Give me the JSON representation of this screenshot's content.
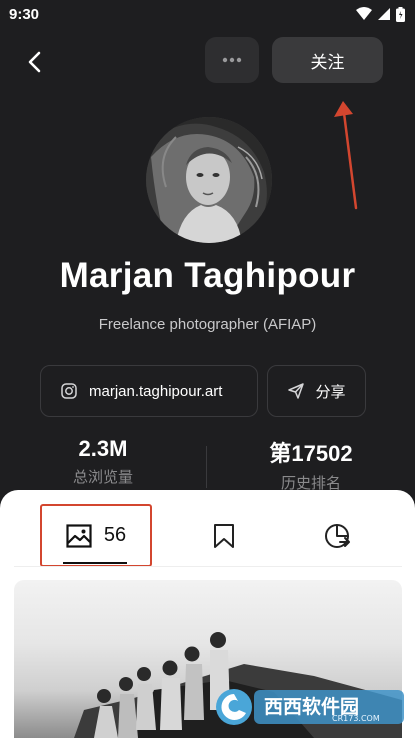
{
  "status_bar": {
    "time": "9:30"
  },
  "header": {
    "follow_label": "关注"
  },
  "profile": {
    "name": "Marjan Taghipour",
    "bio": "Freelance photographer (AFIAP)",
    "instagram_handle": "marjan.taghipour.art",
    "share_label": "分享"
  },
  "stats": {
    "views_value": "2.3M",
    "views_label": "总浏览量",
    "rank_value": "第17502",
    "rank_label": "历史排名"
  },
  "tabs": {
    "gallery_count": "56"
  },
  "watermark": {
    "brand": "西西软件园",
    "site": "CR173.COM"
  },
  "colors": {
    "background": "#1e1e20",
    "annotation_red": "#d3462f",
    "sheet": "#ffffff"
  },
  "icons": [
    "back-icon",
    "more-icon",
    "instagram-icon",
    "share-icon",
    "gallery-icon",
    "bookmark-icon",
    "stats-icon"
  ]
}
